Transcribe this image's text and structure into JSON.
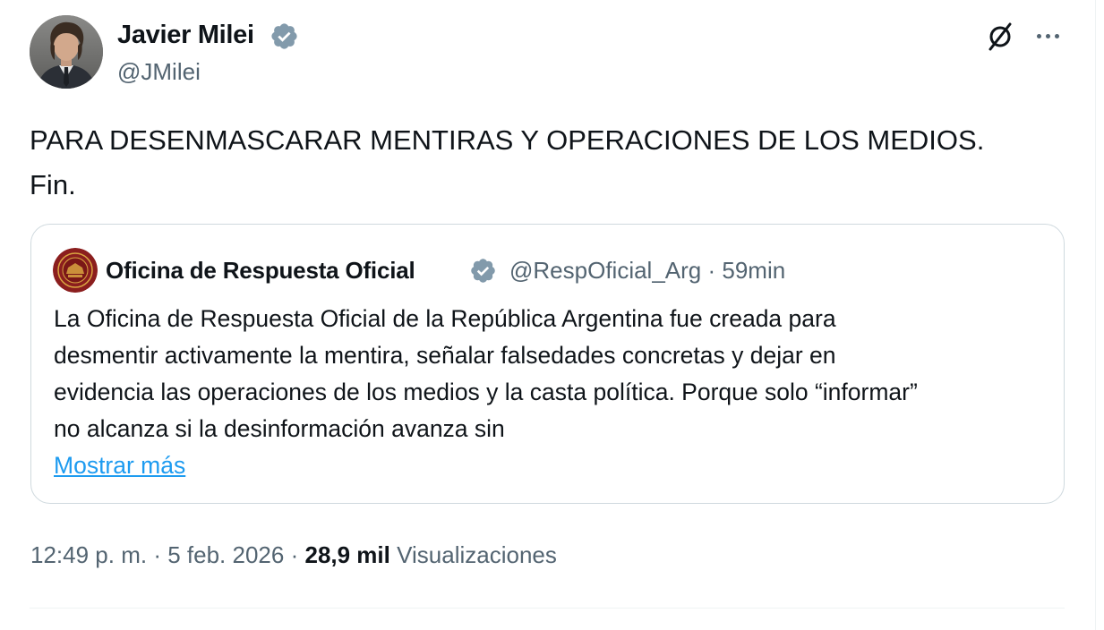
{
  "author": {
    "name": "Javier Milei",
    "handle": "@JMilei",
    "verified": true
  },
  "tweet": {
    "lines": [
      "PARA DESENMASCARAR MENTIRAS Y OPERACIONES DE LOS MEDIOS.",
      "Fin."
    ]
  },
  "quoted_tweet": {
    "name": "Oficina de Respuesta Oficial",
    "handle": "@RespOficial_Arg",
    "separator": "·",
    "time": "59min",
    "verified": true,
    "lines": [
      "La Oficina de Respuesta Oficial de la República Argentina fue creada para",
      "desmentir activamente la mentira, señalar falsedades concretas y dejar en",
      "evidencia las operaciones de los medios y la casta política. Porque solo “informar”",
      "no alcanza si la desinformación avanza sin"
    ],
    "show_more": "Mostrar más"
  },
  "meta": {
    "time": "12:49 p. m.",
    "separator": "·",
    "date": "5 feb. 2026",
    "views_count": "28,9 mil",
    "views_label": "Visualizaciones"
  },
  "icons": {
    "verified": "verified-badge-icon",
    "grok": "grok-icon",
    "more": "more-horizontal-icon"
  },
  "colors": {
    "verified_badge": "#829aab",
    "link": "#1d9bf0",
    "secondary_text": "#536471",
    "primary_text": "#0f1419",
    "border": "#cfd9de"
  }
}
